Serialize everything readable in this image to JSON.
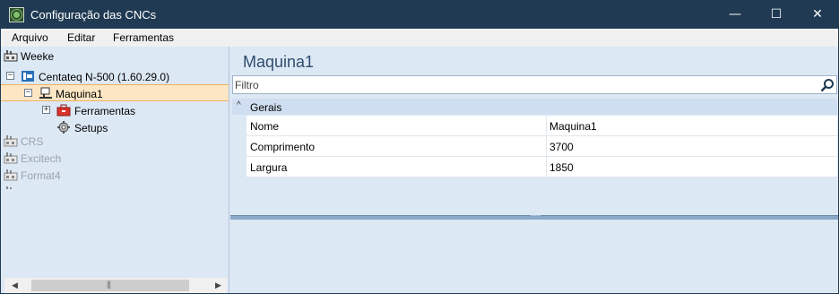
{
  "window": {
    "title": "Configuração das CNCs",
    "min_glyph": "—",
    "max_glyph": "☐",
    "close_glyph": "✕"
  },
  "menu": {
    "items": [
      "Arquivo",
      "Editar",
      "Ferramentas"
    ]
  },
  "tree": {
    "items": [
      {
        "label": "Weeke",
        "icon": "machine-group-icon"
      },
      {
        "label": "Centateq N-500 (1.60.29.0)",
        "icon": "cnc-icon",
        "expander": "−"
      },
      {
        "label": "Maquina1",
        "icon": "machine-icon",
        "expander": "−",
        "selected": true
      },
      {
        "label": "Ferramentas",
        "icon": "toolbox-icon",
        "expander": "+"
      },
      {
        "label": "Setups",
        "icon": "gear-icon"
      },
      {
        "label": "CRS",
        "icon": "machine-group-icon"
      },
      {
        "label": "Excitech",
        "icon": "machine-group-icon"
      },
      {
        "label": "Format4",
        "icon": "machine-group-icon"
      }
    ]
  },
  "scrollbar": {
    "left_arrow": "◀",
    "right_arrow": "▶",
    "grip": "|||"
  },
  "main": {
    "title": "Maquina1",
    "filter_placeholder": "Filtro",
    "group": {
      "label": "Gerais",
      "chevron": "^"
    },
    "properties": [
      {
        "name": "Nome",
        "value": "Maquina1"
      },
      {
        "name": "Comprimento",
        "value": "3700"
      },
      {
        "name": "Largura",
        "value": "1850"
      }
    ],
    "splitter_grip": "·······"
  },
  "colors": {
    "titlebar": "#1f3a52",
    "background": "#dde8f5",
    "selection": "#fde6c4",
    "splitter": "#8aa8c8"
  }
}
